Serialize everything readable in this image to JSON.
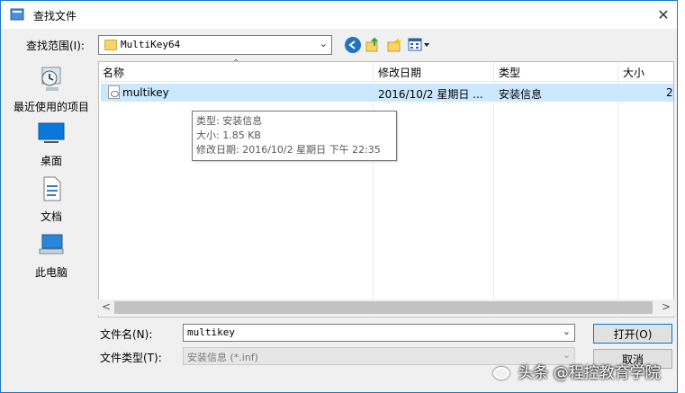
{
  "window": {
    "title": "查找文件"
  },
  "toolbar": {
    "look_in_label": "查找范围(I):",
    "look_in_value": "MultiKey64"
  },
  "places": [
    {
      "label": "最近使用的项目",
      "icon": "recent-places-icon"
    },
    {
      "label": "桌面",
      "icon": "desktop-icon"
    },
    {
      "label": "文档",
      "icon": "documents-icon"
    },
    {
      "label": "此电脑",
      "icon": "this-pc-icon"
    }
  ],
  "list": {
    "columns": [
      "名称",
      "修改日期",
      "类型",
      "大小"
    ],
    "rows": [
      {
        "name": "multikey",
        "modified": "2016/10/2 星期日 ...",
        "type": "安装信息",
        "size": "2"
      }
    ]
  },
  "tooltip": {
    "type_line": "类型: 安装信息",
    "size_line": "大小: 1.85 KB",
    "date_line": "修改日期: 2016/10/2 星期日 下午 22:35"
  },
  "form": {
    "filename_label": "文件名(N):",
    "filename_value": "multikey",
    "filetype_label": "文件类型(T):",
    "filetype_value": "安装信息 (*.inf)"
  },
  "buttons": {
    "open": "打开(O)",
    "cancel": "取消"
  },
  "watermark": {
    "text": "头条 @程控教育学院"
  },
  "colors": {
    "selection": "#cce8ff",
    "accent": "#0078d7",
    "border": "#1979ca"
  }
}
